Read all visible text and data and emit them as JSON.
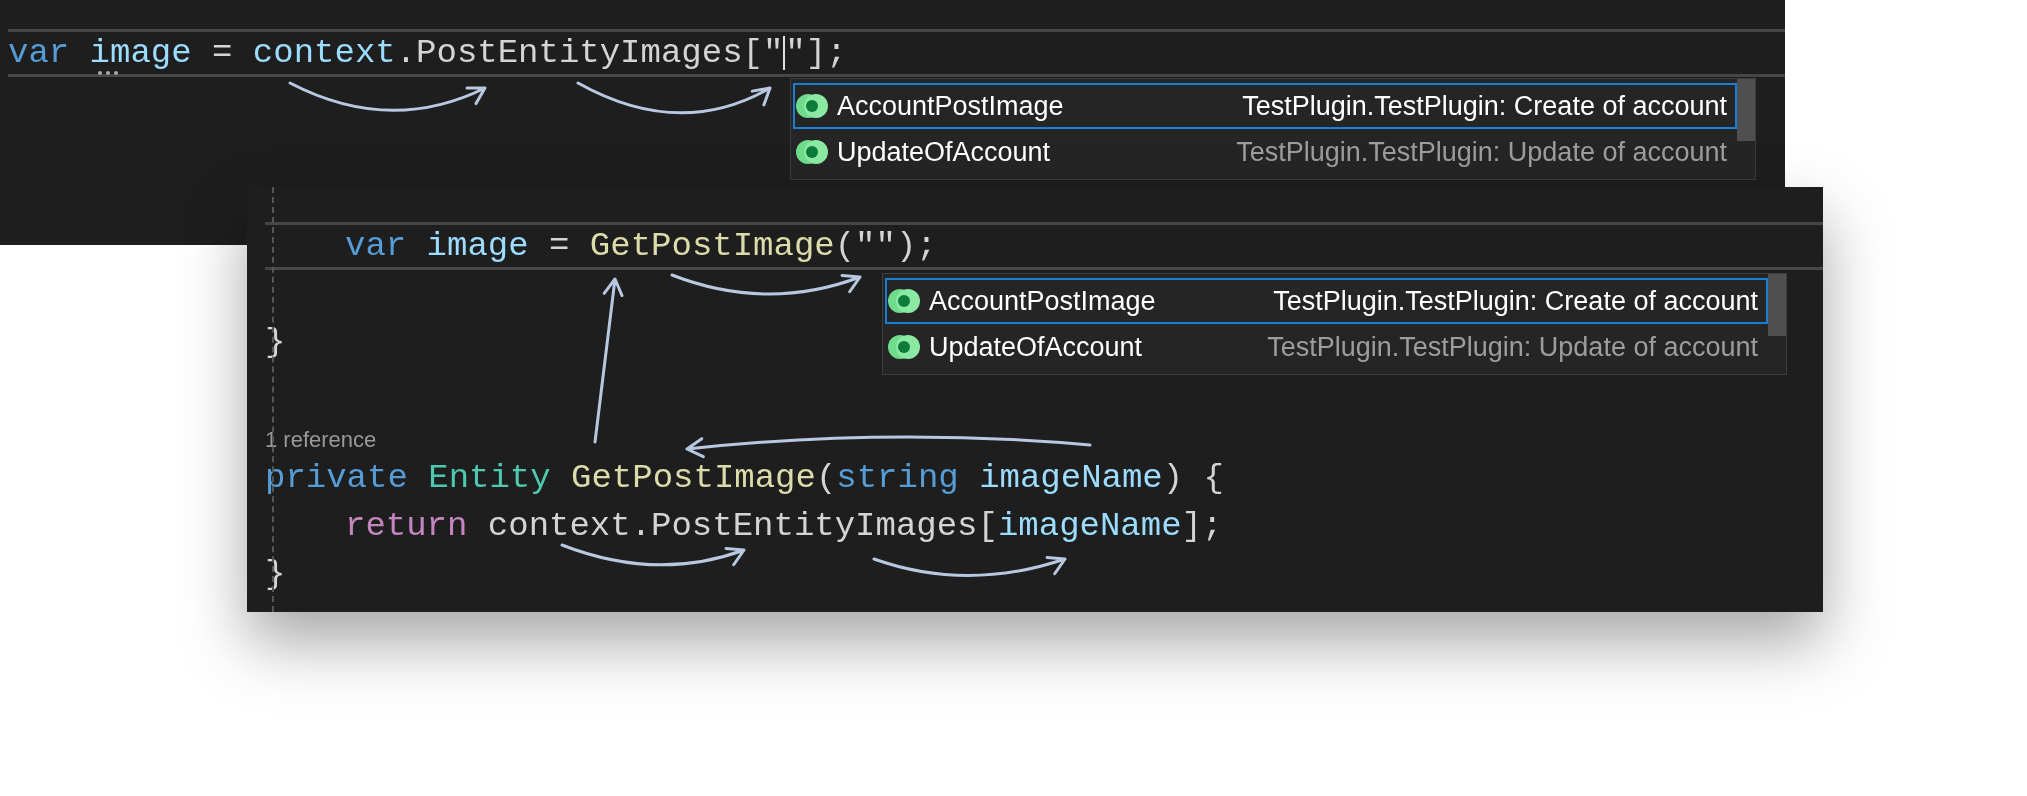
{
  "panels": [
    {
      "lines": [
        {
          "kind": "code",
          "current": true,
          "indented": false,
          "tokens": [
            {
              "kind": "keyword",
              "text": "var"
            },
            {
              "kind": "variable",
              "text": " image"
            },
            {
              "kind": "plain",
              "text": " = "
            },
            {
              "kind": "variable",
              "text": "context"
            },
            {
              "kind": "plain",
              "text": ".PostEntityImages[\""
            },
            {
              "kind": "caret"
            },
            {
              "kind": "plain",
              "text": "\"];"
            }
          ]
        }
      ],
      "autocomplete": {
        "items": [
          {
            "name": "AccountPostImage",
            "detail": "TestPlugin.TestPlugin: Create of account",
            "selected": true
          },
          {
            "name": "UpdateOfAccount",
            "detail": "TestPlugin.TestPlugin: Update of account",
            "selected": false
          }
        ]
      }
    },
    {
      "lines": [
        {
          "kind": "code",
          "current": true,
          "indented": true,
          "tokens": [
            {
              "kind": "keyword",
              "text": "var"
            },
            {
              "kind": "variable",
              "text": " image"
            },
            {
              "kind": "plain",
              "text": " = "
            },
            {
              "kind": "method",
              "text": "GetPostImage"
            },
            {
              "kind": "plain",
              "text": "(\"\");"
            }
          ]
        },
        {
          "kind": "blank"
        },
        {
          "kind": "code",
          "current": false,
          "indented": false,
          "tokens": [
            {
              "kind": "plain",
              "text": "}"
            }
          ]
        },
        {
          "kind": "blank"
        },
        {
          "kind": "codelens",
          "text": "1 reference"
        },
        {
          "kind": "code",
          "current": false,
          "indented": false,
          "tokens": [
            {
              "kind": "keyword",
              "text": "private"
            },
            {
              "kind": "type",
              "text": " Entity"
            },
            {
              "kind": "method",
              "text": " GetPostImage"
            },
            {
              "kind": "plain",
              "text": "("
            },
            {
              "kind": "keyword",
              "text": "string"
            },
            {
              "kind": "variable",
              "text": " imageName"
            },
            {
              "kind": "plain",
              "text": ") {"
            }
          ]
        },
        {
          "kind": "code",
          "current": false,
          "indented": true,
          "tokens": [
            {
              "kind": "control",
              "text": "return"
            },
            {
              "kind": "plain",
              "text": " context.PostEntityImages["
            },
            {
              "kind": "variable",
              "text": "imageName"
            },
            {
              "kind": "plain",
              "text": "];"
            }
          ]
        },
        {
          "kind": "code",
          "current": false,
          "indented": false,
          "tokens": [
            {
              "kind": "plain",
              "text": "}"
            }
          ]
        }
      ],
      "autocomplete": {
        "items": [
          {
            "name": "AccountPostImage",
            "detail": "TestPlugin.TestPlugin: Create of account",
            "selected": true
          },
          {
            "name": "UpdateOfAccount",
            "detail": "TestPlugin.TestPlugin: Update of account",
            "selected": false
          }
        ]
      }
    }
  ]
}
